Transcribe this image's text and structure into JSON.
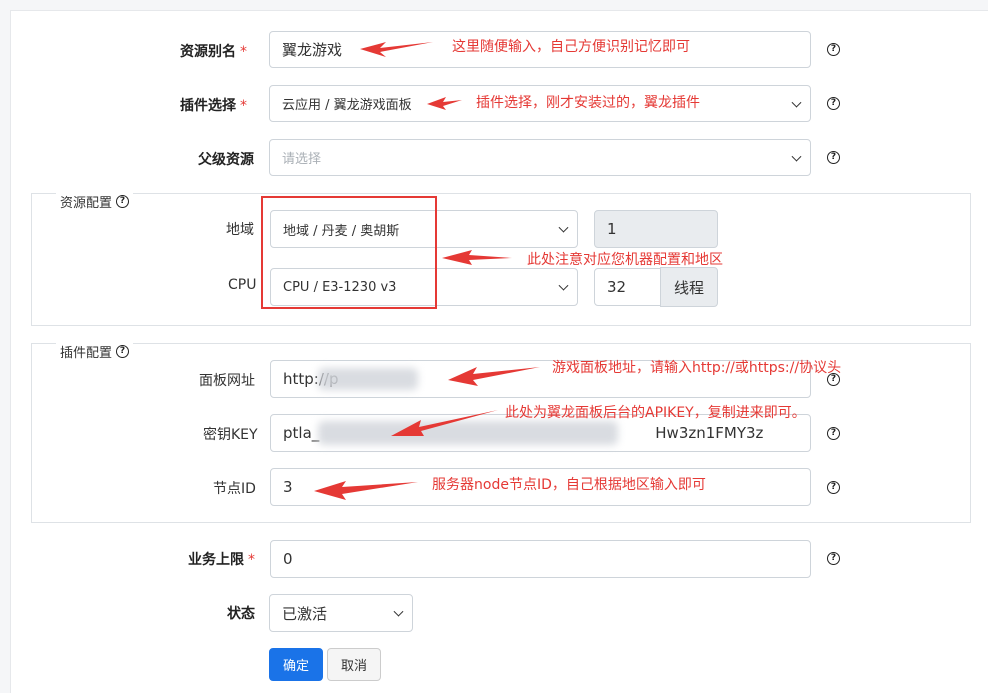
{
  "form": {
    "alias": {
      "label": "资源别名",
      "required_mark": "*",
      "value": "翼龙游戏",
      "help": "?"
    },
    "plugin": {
      "label": "插件选择",
      "required_mark": "*",
      "value": "云应用 / 翼龙游戏面板",
      "help": "?"
    },
    "parent": {
      "label": "父级资源",
      "placeholder": "请选择",
      "help": "?"
    },
    "resource_config": {
      "legend": "资源配置",
      "help": "?",
      "region": {
        "label": "地域",
        "value": "地域 / 丹麦 / 奥胡斯",
        "count": "1"
      },
      "cpu": {
        "label": "CPU",
        "value": "CPU / E3-1230 v3",
        "threads": "32",
        "unit": "线程"
      }
    },
    "plugin_config": {
      "legend": "插件配置",
      "help": "?",
      "panel_url": {
        "label": "面板网址",
        "value": "http://p",
        "help": "?"
      },
      "secret_key": {
        "label": "密钥KEY",
        "value_left": "ptla_",
        "value_right": "Hw3zn1FMY3z",
        "help": "?"
      },
      "node_id": {
        "label": "节点ID",
        "value": "3",
        "help": "?"
      }
    },
    "business_limit": {
      "label": "业务上限",
      "required_mark": "*",
      "value": "0",
      "help": "?"
    },
    "status": {
      "label": "状态",
      "value": "已激活"
    },
    "buttons": {
      "confirm": "确定",
      "cancel": "取消"
    }
  },
  "annotations": {
    "alias_note": "这里随便输入，自己方便识别记忆即可",
    "plugin_note": "插件选择，刚才安装过的，翼龙插件",
    "region_note": "此处注意对应您机器配置和地区",
    "url_note": "游戏面板地址，请输入http://或https://协议头",
    "key_note": "此处为翼龙面板后台的APIKEY，复制进来即可。",
    "node_note": "服务器node节点ID，自己根据地区输入即可",
    "color": "#e53935"
  }
}
